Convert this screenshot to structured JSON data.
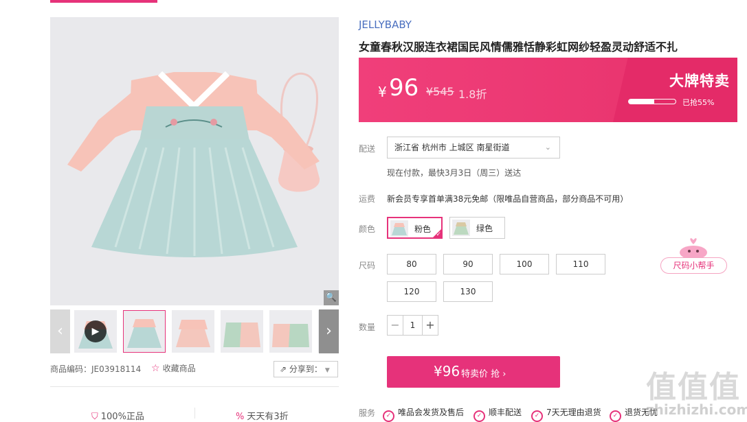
{
  "gallery": {
    "share_label": "分享到：",
    "zoom_icon": "zoom-icon",
    "product_code": "商品编码：JE03918114",
    "favorite_label": "收藏商品",
    "guarantees": [
      "100%正品",
      "天天有3折"
    ]
  },
  "product": {
    "brand": "JELLYBABY",
    "title": "女童春秋汉服连衣裙国民风情儒雅恬静彩虹网纱轻盈灵动舒适不扎"
  },
  "price": {
    "currency": "¥",
    "current": "96",
    "original": "¥545",
    "discount": "1.8折",
    "promo_title": "大牌特卖",
    "sold_text": "已抢55%",
    "sold_fraction": 0.55
  },
  "delivery": {
    "label": "配送",
    "address": "浙江省 杭州市 上城区 南星街道",
    "note": "现在付款，最快3月3日（周三）送达"
  },
  "shipping": {
    "label": "运费",
    "text": "新会员专享首单满38元免邮（限唯品自营商品，部分商品不可用）"
  },
  "color": {
    "label": "颜色",
    "options": [
      {
        "label": "粉色",
        "selected": true
      },
      {
        "label": "绿色",
        "selected": false
      }
    ]
  },
  "size": {
    "label": "尺码",
    "options": [
      "80",
      "90",
      "100",
      "110",
      "120",
      "130"
    ],
    "helper_label": "尺码小帮手"
  },
  "quantity": {
    "label": "数量",
    "value": "1",
    "minus": "−",
    "plus": "+"
  },
  "buy_button": {
    "price": "¥96",
    "text": "特卖价 抢 ›"
  },
  "service": {
    "label": "服务",
    "items": [
      "唯品会发货及售后",
      "顺丰配送",
      "7天无理由退货",
      "退货无忧"
    ]
  },
  "watermark": {
    "glyphs": "值值值",
    "site": "zhizhizhi.com"
  },
  "colors": {
    "accent": "#e6327a",
    "brand_link": "#4a6fbf"
  }
}
